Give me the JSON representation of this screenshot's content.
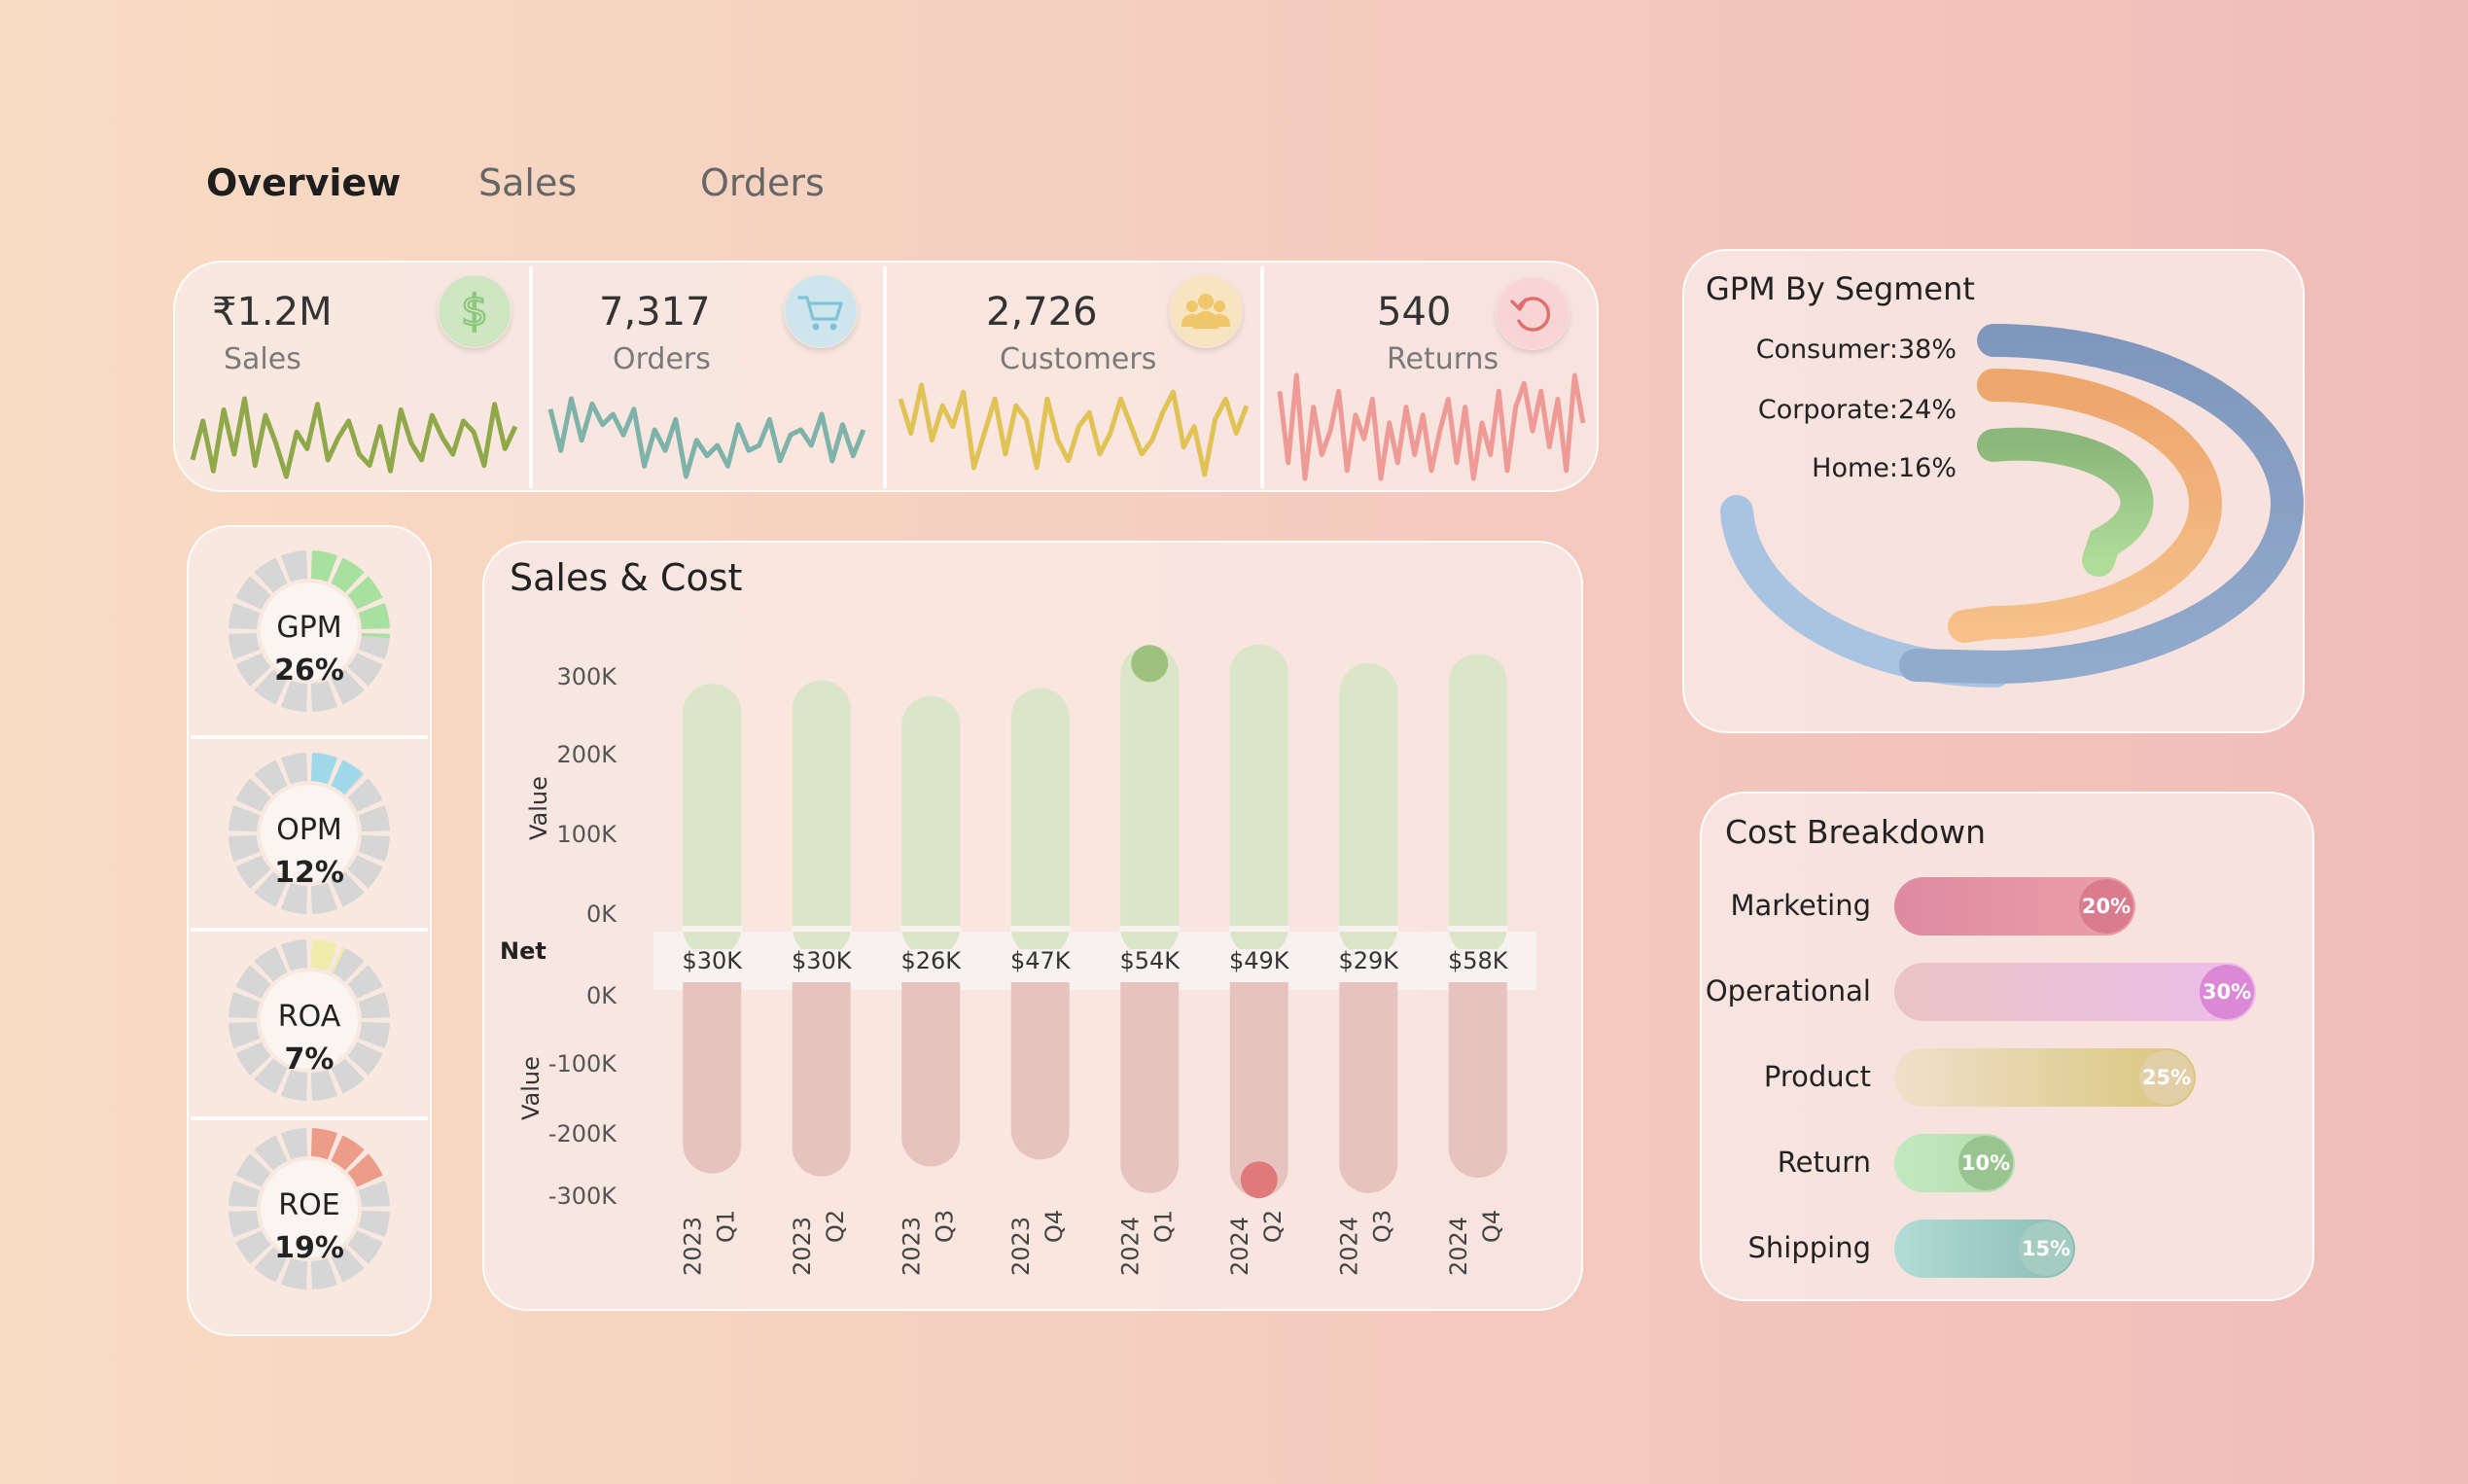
{
  "tabs": [
    {
      "label": "Overview",
      "active": true
    },
    {
      "label": "Sales",
      "active": false
    },
    {
      "label": "Orders",
      "active": false
    }
  ],
  "kpis": [
    {
      "value": "₹1.2M",
      "label": "Sales",
      "icon": "dollar-icon",
      "color": "#8fa94a",
      "icon_bg": "#cfe6c2",
      "icon_color": "#8cc77d",
      "spark": [
        5,
        12,
        3,
        14,
        6,
        16,
        4,
        13,
        8,
        2,
        10,
        7,
        15,
        5,
        9,
        12,
        6,
        4,
        11,
        3,
        14,
        8,
        5,
        13,
        9,
        6,
        12,
        10,
        4,
        15,
        7,
        11
      ]
    },
    {
      "value": "7,317",
      "label": "Orders",
      "icon": "cart-icon",
      "color": "#7fb3a9",
      "icon_bg": "#cfe5ee",
      "icon_color": "#7ec3d8",
      "spark": [
        14,
        6,
        16,
        8,
        15,
        11,
        13,
        9,
        14,
        3,
        10,
        6,
        12,
        1,
        8,
        5,
        7,
        3,
        11,
        6,
        7,
        12,
        4,
        9,
        10,
        7,
        13,
        4,
        11,
        5,
        10
      ]
    },
    {
      "value": "2,726",
      "label": "Customers",
      "icon": "people-icon",
      "color": "#e0c255",
      "icon_bg": "#f8e4c0",
      "icon_color": "#f0c66a",
      "spark": [
        14,
        9,
        16,
        8,
        13,
        10,
        15,
        4,
        9,
        14,
        6,
        13,
        11,
        4,
        14,
        8,
        5,
        10,
        12,
        6,
        9,
        14,
        10,
        6,
        8,
        12,
        15,
        7,
        10,
        3,
        11,
        14,
        9,
        13
      ]
    },
    {
      "value": "540",
      "label": "Returns",
      "icon": "refresh-icon",
      "color": "#ee9a96",
      "icon_bg": "#f8d4d4",
      "icon_color": "#e07070",
      "spark": [
        14,
        5,
        16,
        3,
        12,
        6,
        9,
        14,
        4,
        11,
        8,
        13,
        3,
        10,
        5,
        12,
        6,
        11,
        4,
        9,
        13,
        5,
        12,
        3,
        10,
        6,
        14,
        4,
        12,
        15,
        9,
        14,
        7,
        13,
        4,
        16,
        10
      ]
    }
  ],
  "gauges": [
    {
      "name": "GPM",
      "value": "26%",
      "percent": 26,
      "color": "#a8e0a0"
    },
    {
      "name": "OPM",
      "value": "12%",
      "percent": 12,
      "color": "#9fd8e8"
    },
    {
      "name": "ROA",
      "value": "7%",
      "percent": 7,
      "color": "#f0ecaa"
    },
    {
      "name": "ROE",
      "value": "19%",
      "percent": 19,
      "color": "#ec9c88"
    }
  ],
  "sales_cost": {
    "title": "Sales & Cost",
    "net_label": "Net",
    "ylabel_top": "Value",
    "ylabel_bottom": "Value",
    "top_ticks": [
      "300K",
      "200K",
      "100K",
      "0K"
    ],
    "bottom_ticks": [
      "0K",
      "-100K",
      "-200K",
      "-300K"
    ]
  },
  "chart_data": {
    "type": "bar",
    "categories": [
      [
        "2023",
        "Q1"
      ],
      [
        "2023",
        "Q2"
      ],
      [
        "2023",
        "Q3"
      ],
      [
        "2023",
        "Q4"
      ],
      [
        "2024",
        "Q1"
      ],
      [
        "2024",
        "Q2"
      ],
      [
        "2024",
        "Q3"
      ],
      [
        "2024",
        "Q4"
      ]
    ],
    "series": [
      {
        "name": "Sales",
        "values": [
          312000,
          316000,
          296000,
          306000,
          360000,
          362000,
          338000,
          350000
        ],
        "color": "#dbe5c7"
      },
      {
        "name": "Cost",
        "values": [
          -276000,
          -280000,
          -266000,
          -256000,
          -304000,
          -310000,
          -304000,
          -282000
        ],
        "color": "#e7c3c0"
      }
    ],
    "net_labels": [
      "$30K",
      "$30K",
      "$26K",
      "$47K",
      "$54K",
      "$49K",
      "$29K",
      "$58K"
    ],
    "ylim_top": [
      0,
      380000
    ],
    "ylim_bottom": [
      -330000,
      0
    ],
    "markers": [
      {
        "index": 4,
        "series": "Sales",
        "color": "#9cc27e"
      },
      {
        "index": 5,
        "series": "Cost",
        "color": "#e07a7a"
      }
    ]
  },
  "gpm_segment": {
    "title": "GPM By Segment",
    "segments": [
      {
        "label": "Consumer:38%",
        "percent": 38,
        "color": "#8097bd",
        "color2": "#92aacb"
      },
      {
        "label": "Corporate:24%",
        "percent": 24,
        "color": "#eda66c",
        "color2": "#f5c08a"
      },
      {
        "label": "Home:16%",
        "percent": 16,
        "color": "#8bb87a",
        "color2": "#b0dc9a"
      }
    ],
    "baseline_color": "#a8c4e2"
  },
  "cost_breakdown": {
    "title": "Cost Breakdown",
    "items": [
      {
        "label": "Marketing",
        "percent": 20,
        "text": "20%",
        "c1": "#de8aa0",
        "c2": "#eba0a8",
        "knob": "#d97c8e"
      },
      {
        "label": "Operational",
        "percent": 30,
        "text": "30%",
        "c1": "#eac4c4",
        "c2": "#ecbcea",
        "knob": "#db88d6"
      },
      {
        "label": "Product",
        "percent": 25,
        "text": "25%",
        "c1": "#f0e0cc",
        "c2": "#d8c67a",
        "knob": "#e2cfa8"
      },
      {
        "label": "Return",
        "percent": 10,
        "text": "10%",
        "c1": "#c4e8c0",
        "c2": "#b4dcb0",
        "knob": "#98c490"
      },
      {
        "label": "Shipping",
        "percent": 15,
        "text": "15%",
        "c1": "#b2dcd6",
        "c2": "#8cbcb6",
        "knob": "#a4ccc0"
      }
    ]
  }
}
